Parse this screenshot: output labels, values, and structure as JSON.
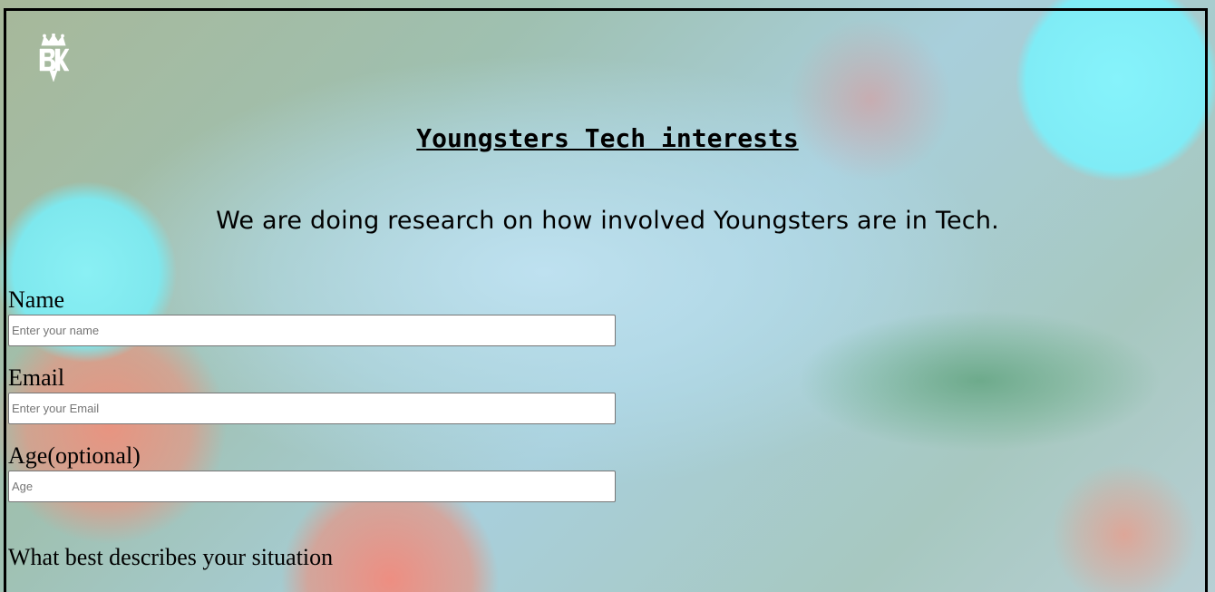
{
  "header": {
    "logo_icon": "crown-bk-logo-icon",
    "title": "Youngsters Tech interests",
    "description": "We are doing research on how involved Youngsters are in Tech."
  },
  "form": {
    "name": {
      "label": "Name",
      "placeholder": "Enter your name"
    },
    "email": {
      "label": "Email",
      "placeholder": "Enter your Email"
    },
    "age": {
      "label": "Age(optional)",
      "placeholder": "Age"
    },
    "situation": {
      "label": "What best describes your situation"
    }
  },
  "colors": {
    "frame_border": "#000000",
    "logo": "#ffffff"
  }
}
